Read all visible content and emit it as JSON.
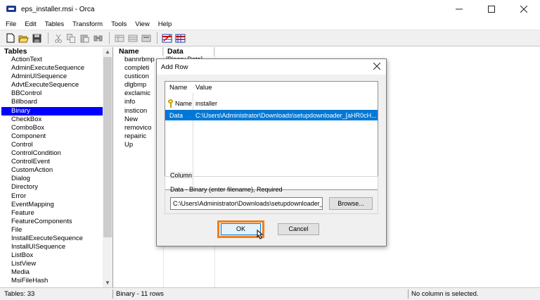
{
  "window": {
    "title": "eps_installer.msi - Orca",
    "controls": [
      "minimize",
      "maximize",
      "close"
    ]
  },
  "menu": [
    "File",
    "Edit",
    "Tables",
    "Transform",
    "Tools",
    "View",
    "Help"
  ],
  "toolbar": {
    "icons": [
      "new-file-icon",
      "open-folder-icon",
      "save-icon",
      "cut-icon",
      "copy-icon",
      "paste-icon",
      "find-icon",
      "add-table-icon",
      "drop-table-icon",
      "add-row-icon",
      "validate-icon",
      "merge-icon"
    ]
  },
  "tables_pane": {
    "header": "Tables",
    "items": [
      "ActionText",
      "AdminExecuteSequence",
      "AdminUISequence",
      "AdvtExecuteSequence",
      "BBControl",
      "Billboard",
      "Binary",
      "CheckBox",
      "ComboBox",
      "Component",
      "Control",
      "ControlCondition",
      "ControlEvent",
      "CustomAction",
      "Dialog",
      "Directory",
      "Error",
      "EventMapping",
      "Feature",
      "FeatureComponents",
      "File",
      "InstallExecuteSequence",
      "InstallUISequence",
      "ListBox",
      "ListView",
      "Media",
      "MsiFileHash"
    ],
    "selected": "Binary"
  },
  "data_pane": {
    "columns": [
      "Name",
      "Data"
    ],
    "rows": [
      "bannrbmp",
      "completi",
      "custicon",
      "dlgbmp",
      "exclamic",
      "info",
      "insticon",
      "New",
      "removico",
      "repairic",
      "Up"
    ],
    "cut_text": "[Binary Data]"
  },
  "status": {
    "tables_count": "Tables: 33",
    "rows_info": "Binary - 11 rows",
    "column_info": "No column is selected."
  },
  "dialog": {
    "title": "Add Row",
    "list_headers": [
      "Name",
      "Value"
    ],
    "rows": [
      {
        "name": "Name",
        "value": "installer"
      },
      {
        "name": "Data",
        "value": "C:\\Users\\Administrator\\Downloads\\setupdownloader_[aHR0cH..."
      }
    ],
    "column_group_label": "Column",
    "column_description": "Data - Binary (enter filename), Required",
    "input_value": "C:\\Users\\Administrator\\Downloads\\setupdownloader_[",
    "browse_label": "Browse...",
    "ok_label": "OK",
    "cancel_label": "Cancel",
    "highlight_color": "#f07f1c"
  }
}
